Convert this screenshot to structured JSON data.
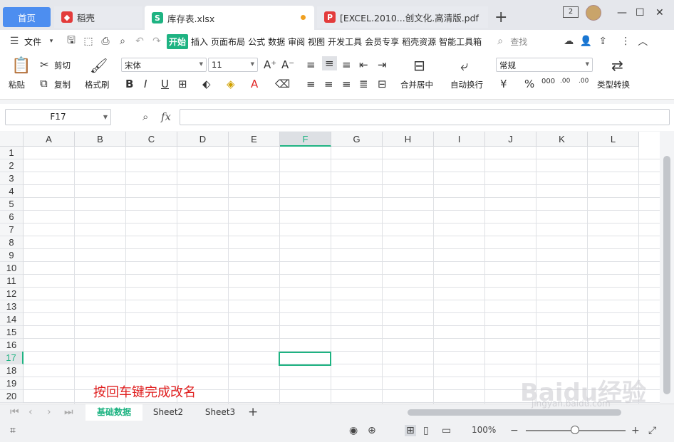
{
  "tabs": {
    "home": "首页",
    "daoke": "稻壳",
    "active_file": "库存表.xlsx",
    "pdf_file": "[EXCEL.2010...创文化.高清版.pdf"
  },
  "menu": {
    "file": "文件",
    "items": [
      "开始",
      "插入",
      "页面布局",
      "公式",
      "数据",
      "审阅",
      "视图",
      "开发工具",
      "会员专享",
      "稻壳资源",
      "智能工具箱"
    ],
    "search": "查找"
  },
  "ribbon": {
    "paste": "粘贴",
    "cut": "剪切",
    "copy": "复制",
    "format_painter": "格式刷",
    "font_name": "宋体",
    "font_size": "11",
    "merge_center": "合并居中",
    "wrap_text": "自动换行",
    "number_format": "常规",
    "type_convert": "类型转换",
    "currency": "¥",
    "percent": "%",
    "thousands": "000",
    "inc_decimal": ".00",
    "dec_decimal": ".00"
  },
  "formula": {
    "name_box": "F17",
    "fx": "fx"
  },
  "grid": {
    "columns": [
      "A",
      "B",
      "C",
      "D",
      "E",
      "F",
      "G",
      "H",
      "I",
      "J",
      "K",
      "L"
    ],
    "rows": [
      "1",
      "2",
      "3",
      "4",
      "5",
      "6",
      "7",
      "8",
      "9",
      "10",
      "11",
      "12",
      "13",
      "14",
      "15",
      "16",
      "17",
      "18",
      "19",
      "20"
    ],
    "selected_column": "F",
    "selected_row": "17"
  },
  "annotation": "按回车键完成改名",
  "sheets": [
    "基础数据",
    "Sheet2",
    "Sheet3"
  ],
  "status": {
    "zoom": "100%"
  },
  "watermark": {
    "main": "Baidu经验",
    "sub": "jingyan.baidu.com"
  },
  "colors": {
    "accent": "#1eb382",
    "home_tab": "#4d8ef0",
    "annotation": "#e02020"
  }
}
